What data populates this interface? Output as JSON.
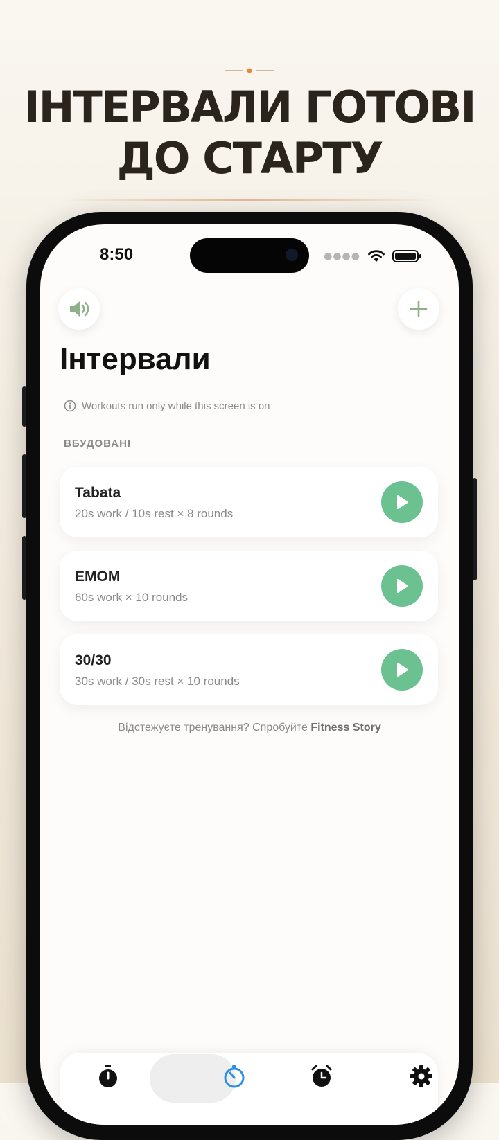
{
  "headline": {
    "line1": "ІНТЕРВАЛИ ГОТОВІ",
    "line2": "ДО СТАРТУ"
  },
  "status_bar": {
    "time": "8:50"
  },
  "header": {
    "title": "Інтервали"
  },
  "notice": {
    "text": "Workouts run only while this screen is on"
  },
  "section": {
    "label": "ВБУДОВАНІ"
  },
  "workouts": [
    {
      "name": "Tabata",
      "description": "20s work / 10s rest × 8 rounds"
    },
    {
      "name": "EMOM",
      "description": "60s work × 10 rounds"
    },
    {
      "name": "30/30",
      "description": "30s work / 30s rest × 10 rounds"
    }
  ],
  "footer": {
    "prefix": "Відстежуєте тренування? Спробуйте ",
    "link": "Fitness Story"
  },
  "tabs": [
    {
      "icon": "stopwatch-icon",
      "active": false
    },
    {
      "icon": "interval-timer-icon",
      "active": true
    },
    {
      "icon": "alarm-clock-icon",
      "active": false
    },
    {
      "icon": "gear-icon",
      "active": false
    }
  ],
  "colors": {
    "accent_green": "#6cc191",
    "active_tab_blue": "#2f8fe0",
    "icon_green": "#8fb08a",
    "headline": "#2a241c"
  }
}
